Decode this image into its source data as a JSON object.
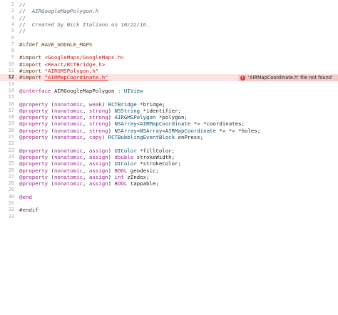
{
  "editor": {
    "lines": [
      {
        "n": "1",
        "parts": [
          {
            "t": "//",
            "c": "cm"
          }
        ]
      },
      {
        "n": "2",
        "parts": [
          {
            "t": "//  AIRGoogleMapPolygon.h",
            "c": "cm"
          }
        ]
      },
      {
        "n": "3",
        "parts": [
          {
            "t": "//",
            "c": "cm"
          }
        ]
      },
      {
        "n": "4",
        "parts": [
          {
            "t": "//  Created by Nick Italiano on 10/22/16.",
            "c": "cm"
          }
        ]
      },
      {
        "n": "5",
        "parts": [
          {
            "t": "//",
            "c": "cm"
          }
        ]
      },
      {
        "n": "6",
        "parts": []
      },
      {
        "n": "7",
        "parts": [
          {
            "t": "#ifdef HAVE_GOOGLE_MAPS",
            "c": "pp"
          }
        ]
      },
      {
        "n": "8",
        "parts": []
      },
      {
        "n": "9",
        "parts": [
          {
            "t": "#import ",
            "c": "pp"
          },
          {
            "t": "<GoogleMaps/GoogleMaps.h>",
            "c": "ppstr"
          }
        ]
      },
      {
        "n": "10",
        "parts": [
          {
            "t": "#import ",
            "c": "pp"
          },
          {
            "t": "<React/RCTBridge.h>",
            "c": "ppstr"
          }
        ]
      },
      {
        "n": "11",
        "parts": [
          {
            "t": "#import ",
            "c": "pp"
          },
          {
            "t": "\"AIRGMSPolygon.h\"",
            "c": "ppstr"
          }
        ]
      },
      {
        "n": "12",
        "error": true,
        "parts": [
          {
            "t": "#import ",
            "c": "pp"
          },
          {
            "t": "\"AIRMapCoordinate.h\"",
            "c": "bad"
          }
        ]
      },
      {
        "n": "13",
        "parts": []
      },
      {
        "n": "14",
        "parts": [
          {
            "t": "@interface ",
            "c": "kw"
          },
          {
            "t": "AIRGoogleMapPolygon : ",
            "c": "pl"
          },
          {
            "t": "UIView",
            "c": "ty"
          }
        ]
      },
      {
        "n": "15",
        "parts": []
      },
      {
        "n": "16",
        "parts": [
          {
            "t": "@property",
            "c": "kw"
          },
          {
            "t": " (",
            "c": "pl"
          },
          {
            "t": "nonatomic",
            "c": "kw"
          },
          {
            "t": ", ",
            "c": "pl"
          },
          {
            "t": "weak",
            "c": "kw"
          },
          {
            "t": ") ",
            "c": "pl"
          },
          {
            "t": "RCTBridge",
            "c": "ty"
          },
          {
            "t": " *bridge;",
            "c": "pl"
          }
        ]
      },
      {
        "n": "17",
        "parts": [
          {
            "t": "@property",
            "c": "kw"
          },
          {
            "t": " (",
            "c": "pl"
          },
          {
            "t": "nonatomic",
            "c": "kw"
          },
          {
            "t": ", ",
            "c": "pl"
          },
          {
            "t": "strong",
            "c": "kw"
          },
          {
            "t": ") ",
            "c": "pl"
          },
          {
            "t": "NSString",
            "c": "ty"
          },
          {
            "t": " *identifier;",
            "c": "pl"
          }
        ]
      },
      {
        "n": "18",
        "parts": [
          {
            "t": "@property",
            "c": "kw"
          },
          {
            "t": " (",
            "c": "pl"
          },
          {
            "t": "nonatomic",
            "c": "kw"
          },
          {
            "t": ", ",
            "c": "pl"
          },
          {
            "t": "strong",
            "c": "kw"
          },
          {
            "t": ") ",
            "c": "pl"
          },
          {
            "t": "AIRGMSPolygon",
            "c": "ty"
          },
          {
            "t": " *polygon;",
            "c": "pl"
          }
        ]
      },
      {
        "n": "19",
        "parts": [
          {
            "t": "@property",
            "c": "kw"
          },
          {
            "t": " (",
            "c": "pl"
          },
          {
            "t": "nonatomic",
            "c": "kw"
          },
          {
            "t": ", ",
            "c": "pl"
          },
          {
            "t": "strong",
            "c": "kw"
          },
          {
            "t": ") ",
            "c": "pl"
          },
          {
            "t": "NSArray",
            "c": "ty"
          },
          {
            "t": "<",
            "c": "pl"
          },
          {
            "t": "AIRMapCoordinate",
            "c": "ty"
          },
          {
            "t": " *> *coordinates;",
            "c": "pl"
          }
        ]
      },
      {
        "n": "20",
        "parts": [
          {
            "t": "@property",
            "c": "kw"
          },
          {
            "t": " (",
            "c": "pl"
          },
          {
            "t": "nonatomic",
            "c": "kw"
          },
          {
            "t": ", ",
            "c": "pl"
          },
          {
            "t": "strong",
            "c": "kw"
          },
          {
            "t": ") ",
            "c": "pl"
          },
          {
            "t": "NSArray",
            "c": "ty"
          },
          {
            "t": "<",
            "c": "pl"
          },
          {
            "t": "NSArray",
            "c": "ty"
          },
          {
            "t": "<",
            "c": "pl"
          },
          {
            "t": "AIRMapCoordinate",
            "c": "ty"
          },
          {
            "t": " *> *> *holes;",
            "c": "pl"
          }
        ]
      },
      {
        "n": "21",
        "parts": [
          {
            "t": "@property",
            "c": "kw"
          },
          {
            "t": " (",
            "c": "pl"
          },
          {
            "t": "nonatomic",
            "c": "kw"
          },
          {
            "t": ", ",
            "c": "pl"
          },
          {
            "t": "copy",
            "c": "kw"
          },
          {
            "t": ") ",
            "c": "pl"
          },
          {
            "t": "RCTBubblingEventBlock",
            "c": "ty"
          },
          {
            "t": " onPress;",
            "c": "pl"
          }
        ]
      },
      {
        "n": "22",
        "parts": []
      },
      {
        "n": "23",
        "parts": [
          {
            "t": "@property",
            "c": "kw"
          },
          {
            "t": " (",
            "c": "pl"
          },
          {
            "t": "nonatomic",
            "c": "kw"
          },
          {
            "t": ", ",
            "c": "pl"
          },
          {
            "t": "assign",
            "c": "kw"
          },
          {
            "t": ") ",
            "c": "pl"
          },
          {
            "t": "UIColor",
            "c": "ty"
          },
          {
            "t": " *fillColor;",
            "c": "pl"
          }
        ]
      },
      {
        "n": "24",
        "parts": [
          {
            "t": "@property",
            "c": "kw"
          },
          {
            "t": " (",
            "c": "pl"
          },
          {
            "t": "nonatomic",
            "c": "kw"
          },
          {
            "t": ", ",
            "c": "pl"
          },
          {
            "t": "assign",
            "c": "kw"
          },
          {
            "t": ") ",
            "c": "pl"
          },
          {
            "t": "double",
            "c": "kw"
          },
          {
            "t": " strokeWidth;",
            "c": "pl"
          }
        ]
      },
      {
        "n": "25",
        "parts": [
          {
            "t": "@property",
            "c": "kw"
          },
          {
            "t": " (",
            "c": "pl"
          },
          {
            "t": "nonatomic",
            "c": "kw"
          },
          {
            "t": ", ",
            "c": "pl"
          },
          {
            "t": "assign",
            "c": "kw"
          },
          {
            "t": ") ",
            "c": "pl"
          },
          {
            "t": "UIColor",
            "c": "ty"
          },
          {
            "t": " *strokeColor;",
            "c": "pl"
          }
        ]
      },
      {
        "n": "26",
        "parts": [
          {
            "t": "@property",
            "c": "kw"
          },
          {
            "t": " (",
            "c": "pl"
          },
          {
            "t": "nonatomic",
            "c": "kw"
          },
          {
            "t": ", ",
            "c": "pl"
          },
          {
            "t": "assign",
            "c": "kw"
          },
          {
            "t": ") ",
            "c": "pl"
          },
          {
            "t": "BOOL",
            "c": "kw"
          },
          {
            "t": " geodesic;",
            "c": "pl"
          }
        ]
      },
      {
        "n": "27",
        "parts": [
          {
            "t": "@property",
            "c": "kw"
          },
          {
            "t": " (",
            "c": "pl"
          },
          {
            "t": "nonatomic",
            "c": "kw"
          },
          {
            "t": ", ",
            "c": "pl"
          },
          {
            "t": "assign",
            "c": "kw"
          },
          {
            "t": ") ",
            "c": "pl"
          },
          {
            "t": "int",
            "c": "kw"
          },
          {
            "t": " zIndex;",
            "c": "pl"
          }
        ]
      },
      {
        "n": "28",
        "parts": [
          {
            "t": "@property",
            "c": "kw"
          },
          {
            "t": " (",
            "c": "pl"
          },
          {
            "t": "nonatomic",
            "c": "kw"
          },
          {
            "t": ", ",
            "c": "pl"
          },
          {
            "t": "assign",
            "c": "kw"
          },
          {
            "t": ") ",
            "c": "pl"
          },
          {
            "t": "BOOL",
            "c": "kw"
          },
          {
            "t": " tappable;",
            "c": "pl"
          }
        ]
      },
      {
        "n": "29",
        "parts": []
      },
      {
        "n": "30",
        "parts": [
          {
            "t": "@end",
            "c": "kw"
          }
        ]
      },
      {
        "n": "31",
        "parts": []
      },
      {
        "n": "32",
        "parts": [
          {
            "t": "#endif",
            "c": "pp"
          }
        ]
      },
      {
        "n": "33",
        "parts": []
      }
    ],
    "error": {
      "line": "12",
      "message": "'AIRMapCoordinate.h' file not found",
      "icon": "error-icon"
    }
  },
  "colors": {
    "comment": "#5d6c79",
    "preprocessor": "#643820",
    "string": "#c41a16",
    "keyword": "#9b2393",
    "type": "#0b4f79",
    "error_line_bg": "#fbe3e4",
    "error_badge_bg": "#f6c9cb",
    "error_icon": "#e0352b"
  }
}
